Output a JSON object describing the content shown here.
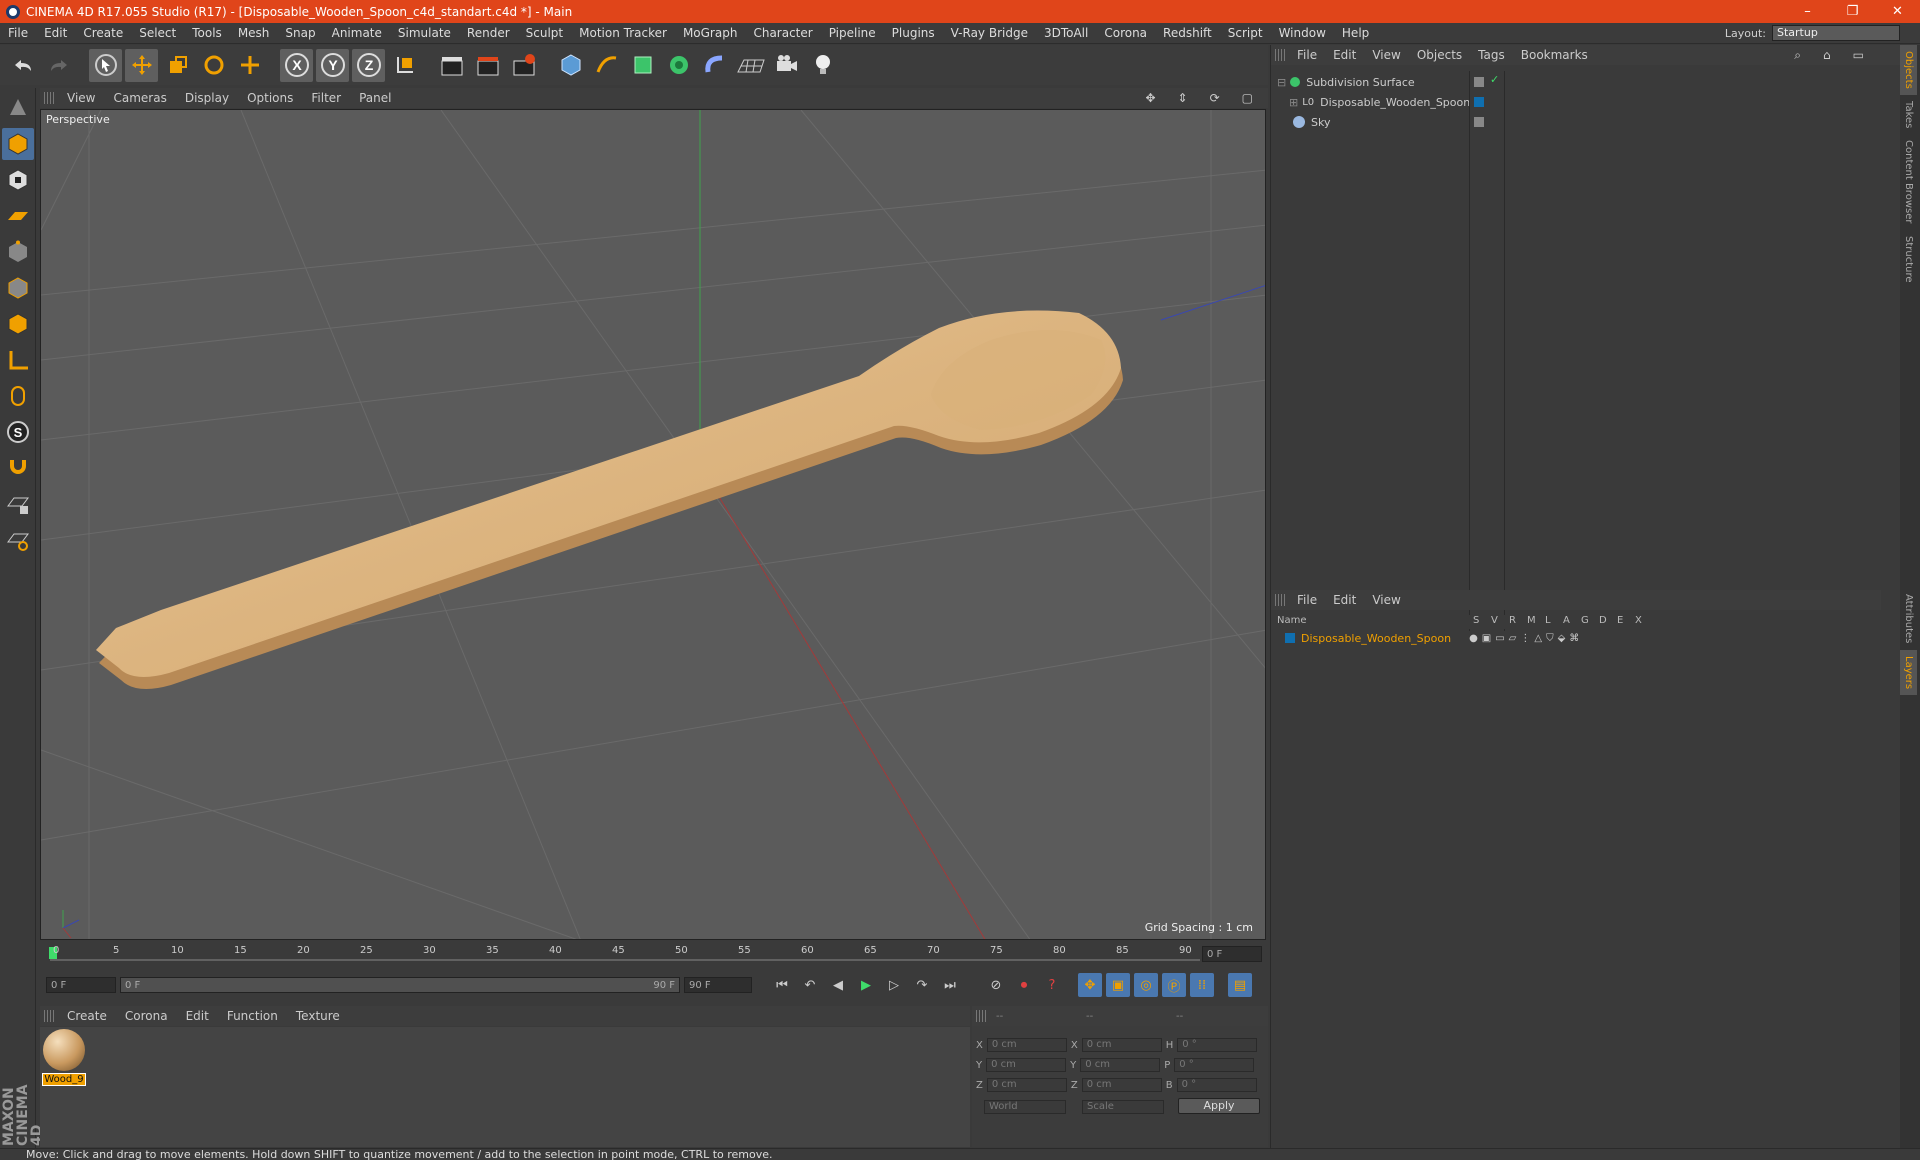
{
  "titlebar": {
    "title": "CINEMA 4D R17.055 Studio (R17) - [Disposable_Wooden_Spoon_c4d_standart.c4d *] - Main",
    "minimize": "–",
    "restore": "❐",
    "close": "✕"
  },
  "menu": [
    "File",
    "Edit",
    "Create",
    "Select",
    "Tools",
    "Mesh",
    "Snap",
    "Animate",
    "Simulate",
    "Render",
    "Sculpt",
    "Motion Tracker",
    "MoGraph",
    "Character",
    "Pipeline",
    "Plugins",
    "V-Ray Bridge",
    "3DToAll",
    "Corona",
    "Redshift",
    "Script",
    "Window",
    "Help"
  ],
  "layout": {
    "label": "Layout:",
    "value": "Startup"
  },
  "toolbar": {
    "axis_x": "X",
    "axis_y": "Y",
    "axis_z": "Z"
  },
  "viewport": {
    "menu": [
      "View",
      "Cameras",
      "Display",
      "Options",
      "Filter",
      "Panel"
    ],
    "label": "Perspective",
    "grid": "Grid Spacing : 1 cm"
  },
  "timeline": {
    "ticks": [
      "0",
      "5",
      "10",
      "15",
      "20",
      "25",
      "30",
      "35",
      "40",
      "45",
      "50",
      "55",
      "60",
      "65",
      "70",
      "75",
      "80",
      "85",
      "90"
    ],
    "current": "0 F",
    "start": "0 F",
    "range_start": "0 F",
    "range_end": "90 F",
    "end": "90 F"
  },
  "materials": {
    "menu": [
      "Create",
      "Corona",
      "Edit",
      "Function",
      "Texture"
    ],
    "items": [
      {
        "name": "Wood_9"
      }
    ]
  },
  "coords": {
    "hdr": [
      "--",
      "--",
      "--"
    ],
    "rows": [
      {
        "a": "X",
        "av": "0 cm",
        "b": "X",
        "bv": "0 cm",
        "c": "H",
        "cv": "0 °"
      },
      {
        "a": "Y",
        "av": "0 cm",
        "b": "Y",
        "bv": "0 cm",
        "c": "P",
        "cv": "0 °"
      },
      {
        "a": "Z",
        "av": "0 cm",
        "b": "Z",
        "bv": "0 cm",
        "c": "B",
        "cv": "0 °"
      }
    ],
    "world": "World",
    "scale": "Scale",
    "apply": "Apply"
  },
  "objects": {
    "menu": [
      "File",
      "Edit",
      "View",
      "Objects",
      "Tags",
      "Bookmarks"
    ],
    "items": [
      {
        "name": "Subdivision Surface"
      },
      {
        "name": "Disposable_Wooden_Spoon"
      },
      {
        "name": "Sky"
      }
    ]
  },
  "layers": {
    "menu": [
      "File",
      "Edit",
      "View"
    ],
    "cols": [
      "Name",
      "S",
      "V",
      "R",
      "M",
      "L",
      "A",
      "G",
      "D",
      "E",
      "X"
    ],
    "items": [
      {
        "name": "Disposable_Wooden_Spoon"
      }
    ]
  },
  "sidetabs": [
    "Objects",
    "Takes",
    "Content Browser",
    "Structure",
    "Attributes",
    "Layers"
  ],
  "status": "Move: Click and drag to move elements. Hold down SHIFT to quantize movement / add to the selection in point mode, CTRL to remove.",
  "brand": "MAXON CINEMA 4D",
  "colors": {
    "accent": "#e0451a",
    "selection": "#f0a000"
  }
}
